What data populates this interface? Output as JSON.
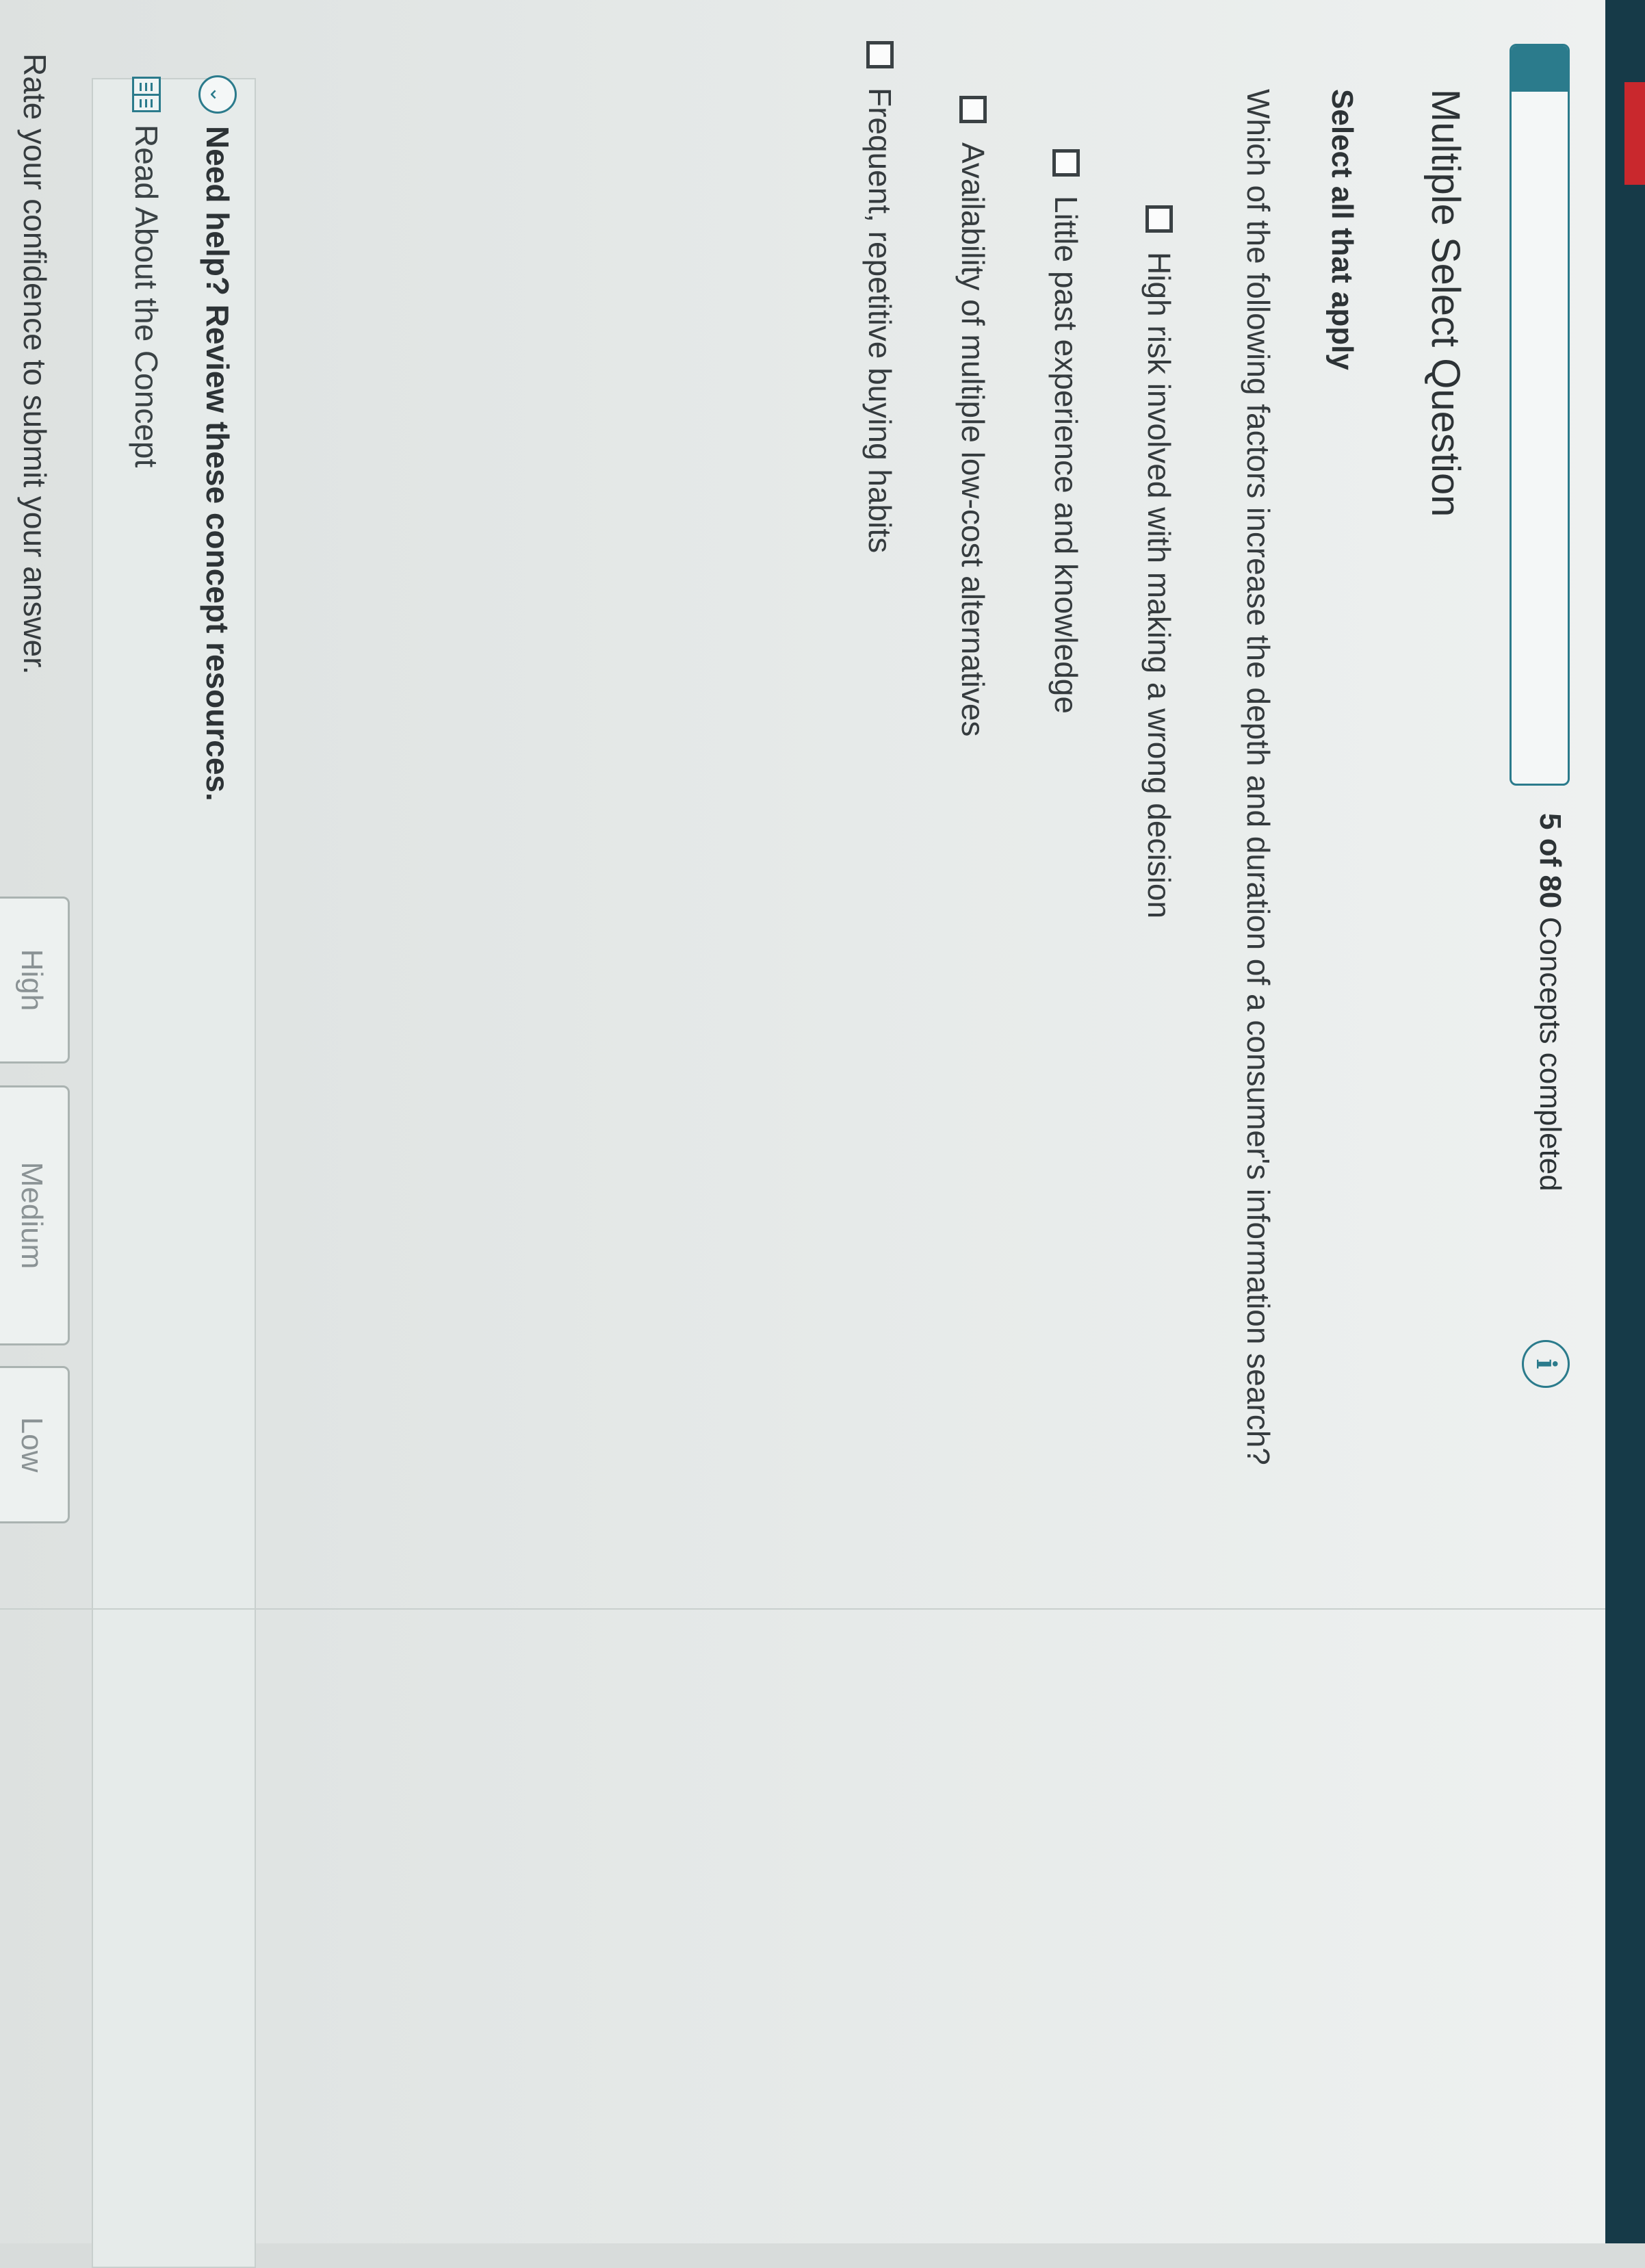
{
  "progress": {
    "count": "5 of 80",
    "suffix": " Concepts completed",
    "fraction": 0.0625
  },
  "question": {
    "type_title": "Multiple Select Question",
    "instruction": "Select all that apply",
    "prompt": "Which of the following factors increase the depth and duration of a consumer's information search?",
    "options": [
      {
        "label": "High risk involved with making a wrong decision",
        "checked": false
      },
      {
        "label": "Little past experience and knowledge",
        "checked": false
      },
      {
        "label": "Availability of multiple low-cost alternatives",
        "checked": false
      },
      {
        "label": "Frequent, repetitive buying habits",
        "checked": false
      }
    ]
  },
  "help": {
    "title": "Need help? Review these concept resources.",
    "link_label": "Read About the Concept"
  },
  "confidence": {
    "prompt": "Rate your confidence to submit your answer.",
    "buttons": [
      "High",
      "Medium",
      "Low"
    ]
  },
  "colors": {
    "accent": "#2b7b8c",
    "sidebar": "#163a48",
    "alert": "#c9282d"
  }
}
